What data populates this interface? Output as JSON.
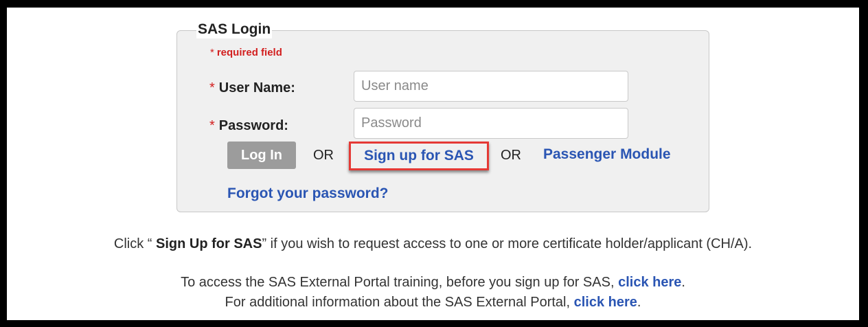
{
  "login": {
    "title": "SAS Login",
    "required_star": "*",
    "required_note": "required field",
    "username_label": "User Name:",
    "username_placeholder": "User name",
    "password_label": "Password:",
    "password_placeholder": "Password",
    "login_button": "Log In",
    "or_1": "OR",
    "signup_link": "Sign up for SAS",
    "or_2": "OR",
    "passenger_link": "Passenger Module",
    "forgot_link": "Forgot your password?"
  },
  "info": {
    "line1_prefix": "Click “ ",
    "line1_bold": "Sign Up for SAS",
    "line1_suffix": "” if you wish to request access to one or more certificate holder/applicant (CH/A).",
    "line2_prefix": "To access the SAS External Portal training, before you sign up for SAS, ",
    "line2_link": "click here",
    "line2_suffix": ".",
    "line3_prefix": "For additional information about the SAS External Portal, ",
    "line3_link": "click here",
    "line3_suffix": "."
  },
  "colors": {
    "required": "#d21f1f",
    "link": "#2a55b3",
    "highlight_border": "#e53935",
    "button_bg": "#9c9c9c",
    "panel_bg": "#f0f0f0"
  }
}
